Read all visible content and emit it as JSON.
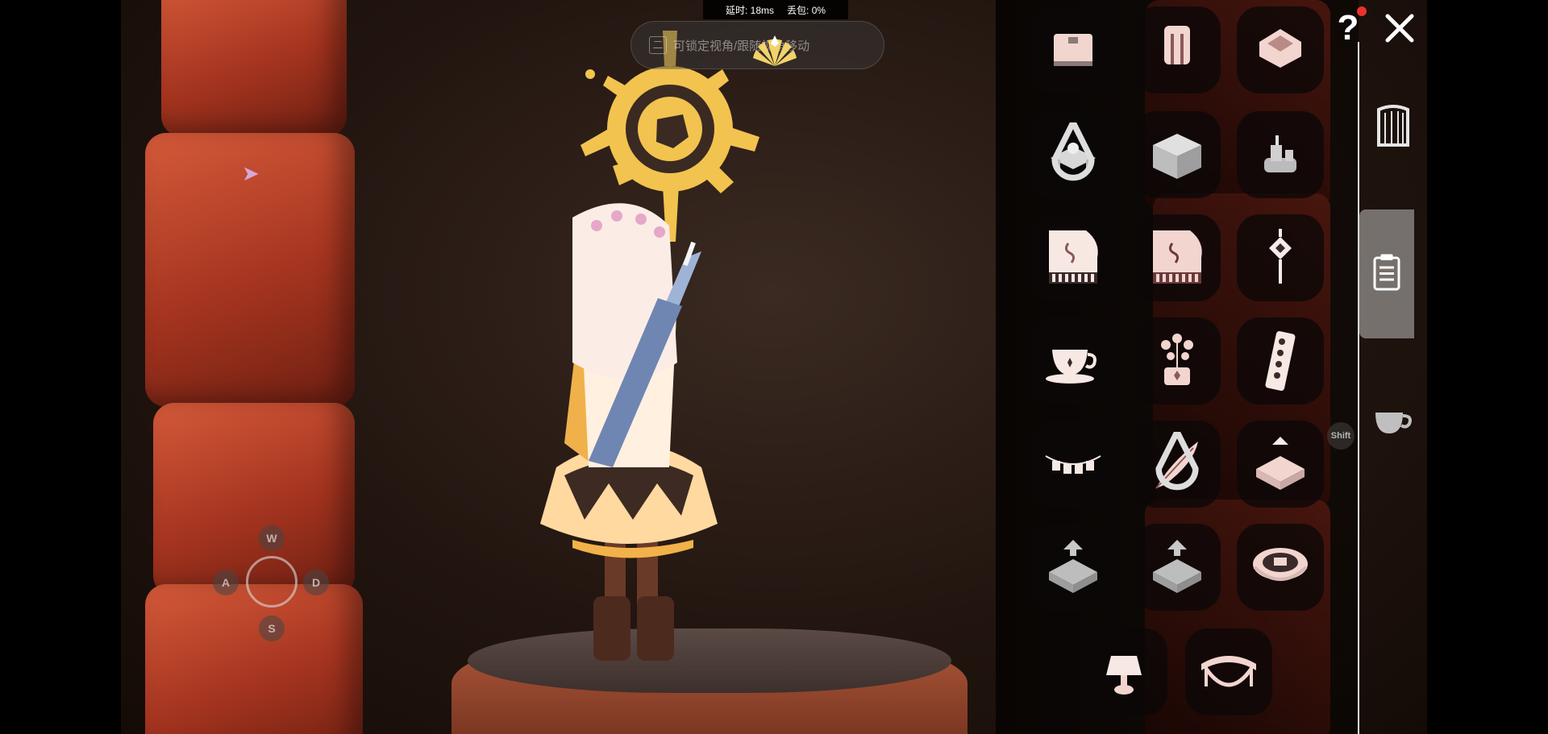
{
  "hud": {
    "latency_label": "延时:",
    "latency_value": "18ms",
    "packet_loss_label": "丢包:",
    "packet_loss_value": "0%",
    "hint_key": "二",
    "hint_text": "可锁定视角/跟随视角移动"
  },
  "movement": {
    "up": "W",
    "left": "A",
    "right": "D",
    "down": "S"
  },
  "shortcut": {
    "shift": "Shift"
  },
  "help_label": "?",
  "panel": {
    "items": [
      {
        "name": "nightstand",
        "icon": "cabinet-icon"
      },
      {
        "name": "robe",
        "icon": "robe-icon"
      },
      {
        "name": "cushion",
        "icon": "cushion-icon"
      },
      {
        "name": "tea-table",
        "icon": "tea-table-icon",
        "badge": "drop"
      },
      {
        "name": "storage-box",
        "icon": "box-icon"
      },
      {
        "name": "candles",
        "icon": "candles-icon"
      },
      {
        "name": "grand-piano",
        "icon": "piano-icon"
      },
      {
        "name": "grand-piano-dark",
        "icon": "piano-dark-icon"
      },
      {
        "name": "lantern",
        "icon": "lantern-icon"
      },
      {
        "name": "teacup",
        "icon": "teacup-icon"
      },
      {
        "name": "flower-pot",
        "icon": "flower-pot-icon"
      },
      {
        "name": "domino",
        "icon": "domino-icon"
      },
      {
        "name": "bunting",
        "icon": "bunting-icon"
      },
      {
        "name": "feather-quill",
        "icon": "feather-icon",
        "badge": "drop"
      },
      {
        "name": "pedestal-up",
        "icon": "pedestal-up-icon"
      },
      {
        "name": "pedestal-raise",
        "icon": "raise-icon"
      },
      {
        "name": "pedestal-raise-2",
        "icon": "raise-icon"
      },
      {
        "name": "round-rug",
        "icon": "rug-icon"
      },
      {
        "name": "lamp",
        "icon": "lamp-icon"
      },
      {
        "name": "hammock",
        "icon": "hammock-icon"
      }
    ]
  },
  "tabs": [
    {
      "name": "harp",
      "icon": "harp-icon"
    },
    {
      "name": "list",
      "icon": "list-icon",
      "active": true
    },
    {
      "name": "teacup",
      "icon": "teacup-tab-icon"
    }
  ],
  "colors": {
    "accent_gold": "#f2c34e",
    "notification": "#e8322c",
    "icon_pink": "#f3d5d0"
  }
}
